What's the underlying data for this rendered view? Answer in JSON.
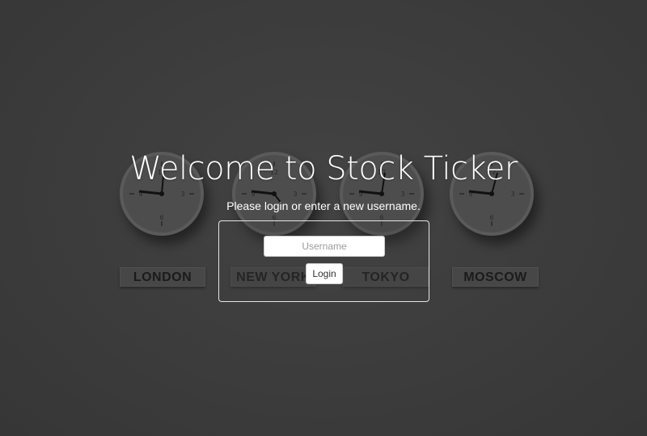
{
  "page": {
    "title": "Welcome to Stock Ticker",
    "subtitle": "Please login or enter a new username."
  },
  "login": {
    "username_placeholder": "Username",
    "username_value": "",
    "button_label": "Login"
  },
  "clocks": [
    {
      "city": "LONDON"
    },
    {
      "city": "NEW YORK"
    },
    {
      "city": "TOKYO"
    },
    {
      "city": "MOSCOW"
    }
  ],
  "colors": {
    "background": "#3b3b3b",
    "text": "#ffffff",
    "box_border": "#e6e6e6"
  }
}
